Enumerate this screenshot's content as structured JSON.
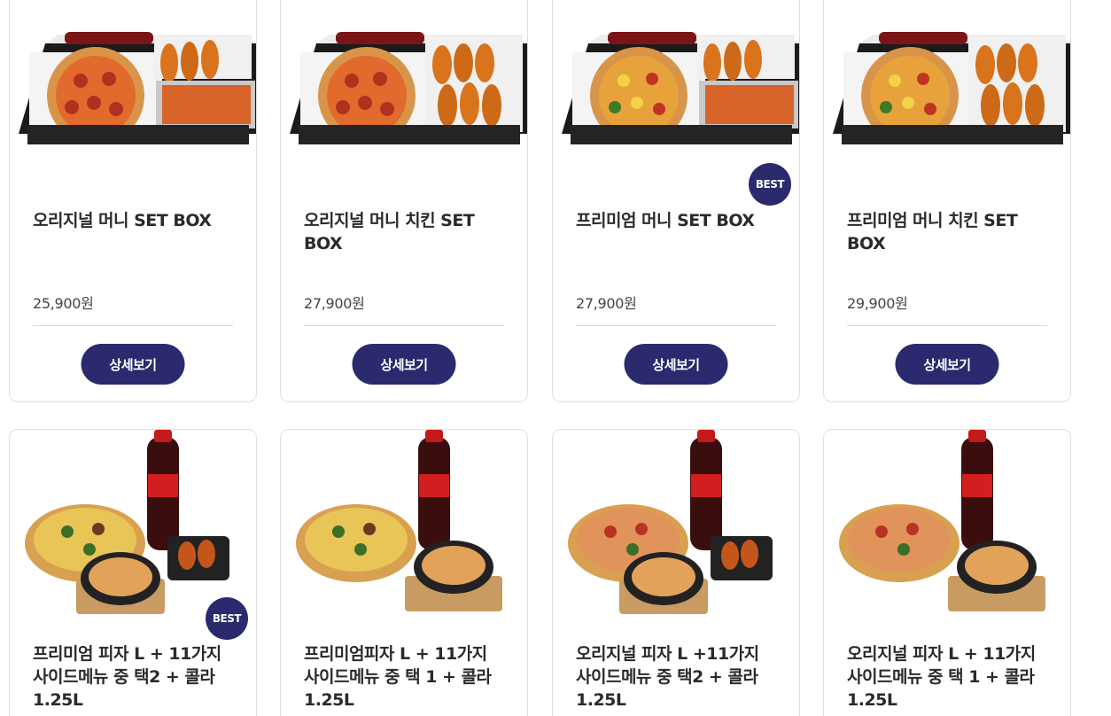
{
  "colors": {
    "accent": "#2b2a6e",
    "border": "#dedede"
  },
  "products": [
    {
      "title": "오리지널 머니 SET BOX",
      "price": "25,900원",
      "button": "상세보기",
      "badge": "",
      "image": "set-box-pizza-shrimp-chicken"
    },
    {
      "title": "오리지널 머니 치킨 SET BOX",
      "price": "27,900원",
      "button": "상세보기",
      "badge": "",
      "image": "set-box-pizza-chicken"
    },
    {
      "title": "프리미엄 머니 SET BOX",
      "price": "27,900원",
      "button": "상세보기",
      "badge": "BEST",
      "image": "set-box-premium-pizza-shrimp-chicken"
    },
    {
      "title": "프리미엄 머니 치킨 SET BOX",
      "price": "29,900원",
      "button": "상세보기",
      "badge": "",
      "image": "set-box-premium-pizza-chicken"
    },
    {
      "title": "프리미엄 피자 L + 11가지 사이드메뉴 중 택2 + 콜라 1.25L",
      "badge": "BEST",
      "image": "premium-pizza-cola-two-sides"
    },
    {
      "title": "프리미엄피자 L + 11가지 사이드메뉴 중 택 1 + 콜라 1.25L",
      "badge": "",
      "image": "premium-pizza-cola-one-side"
    },
    {
      "title": "오리지널 피자 L +11가지 사이드메뉴 중 택2 + 콜라 1.25L",
      "badge": "",
      "image": "original-pizza-cola-two-sides"
    },
    {
      "title": "오리지널 피자 L + 11가지 사이드메뉴 중 택 1 + 콜라 1.25L",
      "badge": "",
      "image": "original-pizza-cola-one-side"
    }
  ]
}
